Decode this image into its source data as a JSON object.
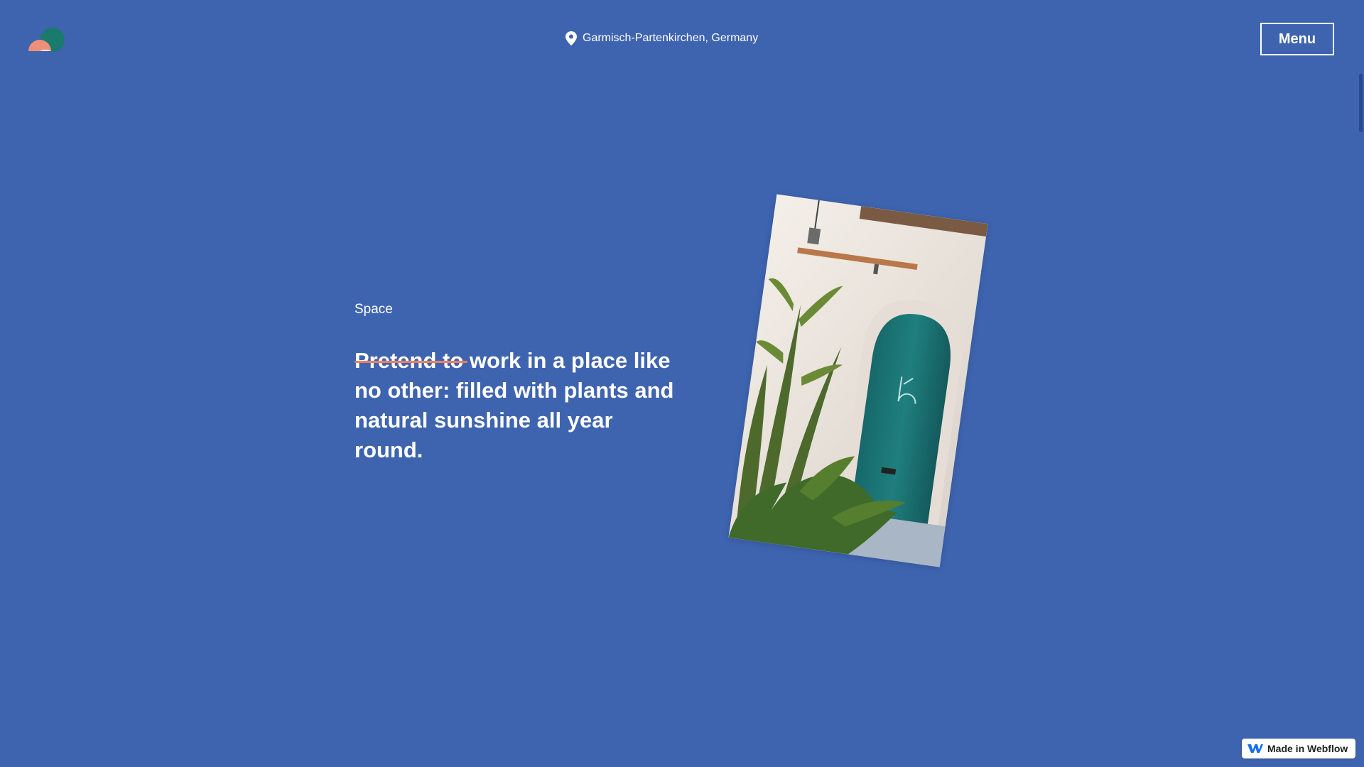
{
  "header": {
    "logo_icon": "half-circles-logo-icon",
    "location_icon": "map-pin-icon",
    "location": "Garmisch-Partenkirchen, Germany",
    "menu_label": "Menu"
  },
  "main": {
    "section_label": "Space",
    "headline_struck": "Pretend to",
    "headline_rest": " work in a place like no other: filled with plants and natural sunshine all year round."
  },
  "badge": {
    "icon": "webflow-logo-icon",
    "label": "Made in Webflow"
  },
  "colors": {
    "background": "#3e64b0",
    "accent_strike": "#ee7f5e",
    "door_teal": "#1f7f7e",
    "text": "#ffffff"
  }
}
